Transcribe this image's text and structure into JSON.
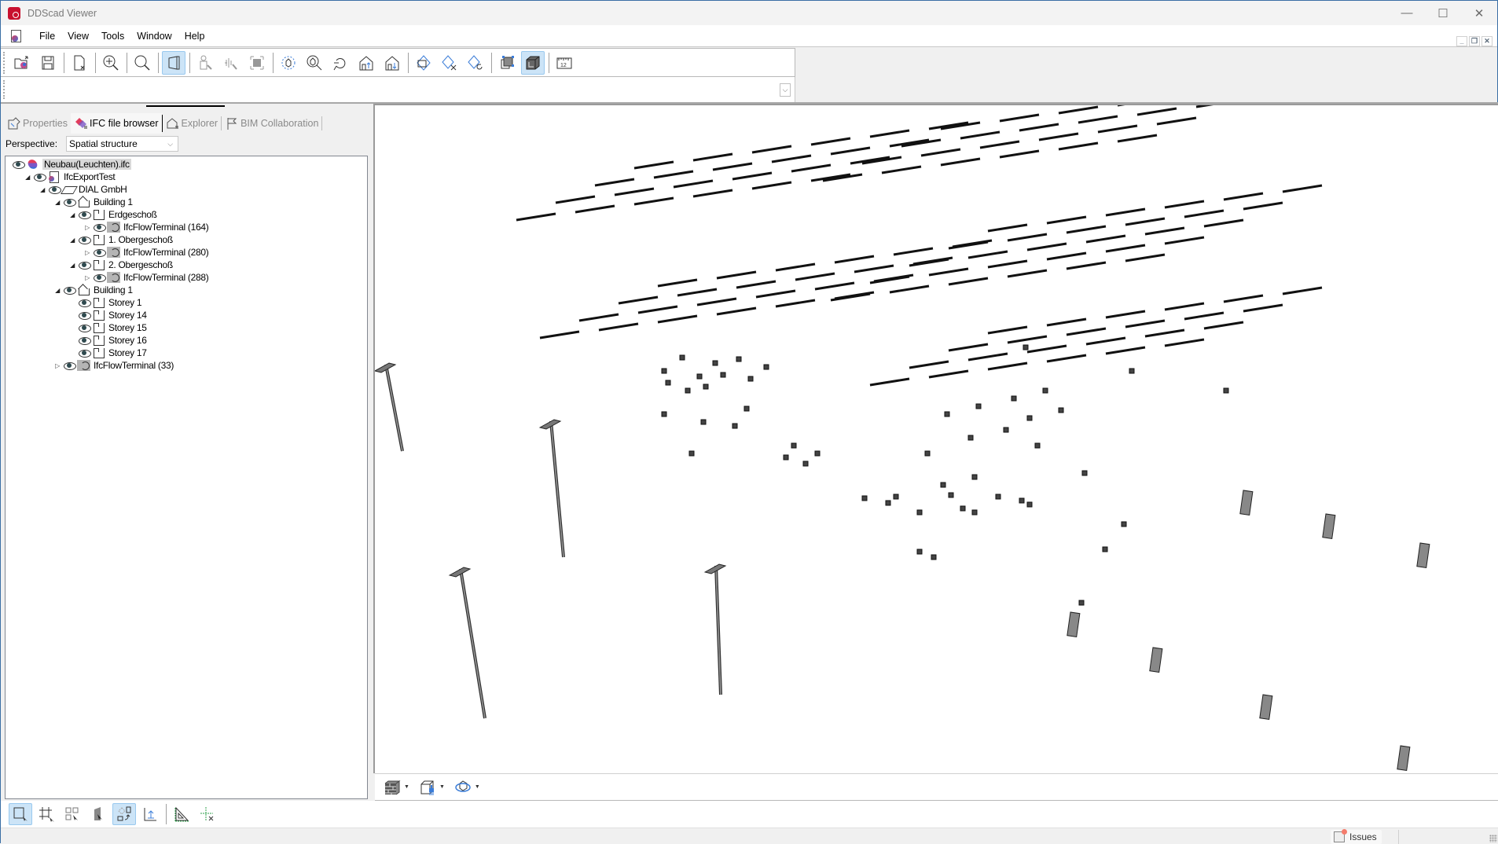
{
  "window": {
    "title": "DDScad Viewer",
    "controls": {
      "minimize": "—",
      "maximize": "☐",
      "close": "✕"
    }
  },
  "menubar": {
    "items": [
      "File",
      "View",
      "Tools",
      "Window",
      "Help"
    ],
    "mdi_controls": {
      "minimize": "_",
      "restore": "❐",
      "close": "✕"
    }
  },
  "toolbar": {
    "buttons": [
      {
        "name": "open-file",
        "icon": "folder-open-icon",
        "active": false
      },
      {
        "name": "save",
        "icon": "save-icon",
        "active": false
      },
      {
        "name": "close-file",
        "icon": "document-close-icon",
        "active": false
      },
      {
        "name": "zoom-extents",
        "icon": "zoom-extents-icon",
        "active": false
      },
      {
        "name": "zoom",
        "icon": "magnifier-icon",
        "active": false
      },
      {
        "name": "perspective",
        "icon": "perspective-box-icon",
        "active": true
      },
      {
        "name": "walk",
        "icon": "person-walk-icon",
        "active": false
      },
      {
        "name": "fly",
        "icon": "fly-icon",
        "active": false
      },
      {
        "name": "fit-selection",
        "icon": "fit-selection-icon",
        "active": false
      },
      {
        "name": "orbit",
        "icon": "orbit-icon",
        "active": false
      },
      {
        "name": "zoom-object",
        "icon": "zoom-object-icon",
        "active": false
      },
      {
        "name": "previous-view",
        "icon": "undo-view-icon",
        "active": false
      },
      {
        "name": "storey-up",
        "icon": "house-arrow-up-icon",
        "active": false
      },
      {
        "name": "storey-down",
        "icon": "house-arrow-down-icon",
        "active": false
      },
      {
        "name": "section-box",
        "icon": "section-box-icon",
        "active": false
      },
      {
        "name": "clip",
        "icon": "clip-scissors-icon",
        "active": false
      },
      {
        "name": "reset-clip",
        "icon": "clip-reset-icon",
        "active": false
      },
      {
        "name": "select-frame",
        "icon": "frame-select-icon",
        "active": false
      },
      {
        "name": "shaded-3d",
        "icon": "shaded-cube-icon",
        "active": true
      },
      {
        "name": "measure",
        "icon": "ruler-icon",
        "active": false
      }
    ]
  },
  "left_panel": {
    "tabs": [
      {
        "label": "Properties",
        "icon": "properties-icon",
        "active": false
      },
      {
        "label": "IFC file browser",
        "icon": "ifc-browser-icon",
        "active": true
      },
      {
        "label": "Explorer",
        "icon": "explorer-icon",
        "active": false
      },
      {
        "label": "BIM Collaboration",
        "icon": "flag-icon",
        "active": false
      }
    ],
    "perspective": {
      "label": "Perspective:",
      "value": "Spatial structure"
    },
    "tree": [
      {
        "label": "Neubau(Leuchten).ifc",
        "level": 0,
        "twisty": "",
        "icon": "ifc",
        "selected": true
      },
      {
        "label": "IfcExportTest",
        "level": 1,
        "twisty": "expanded",
        "icon": "doc"
      },
      {
        "label": "DIAL GmbH",
        "level": 2,
        "twisty": "expanded",
        "icon": "site"
      },
      {
        "label": "Building 1",
        "level": 3,
        "twisty": "expanded",
        "icon": "bldg"
      },
      {
        "label": "Erdgeschoß",
        "level": 4,
        "twisty": "expanded",
        "icon": "storey"
      },
      {
        "label": "IfcFlowTerminal (164)",
        "level": 5,
        "twisty": "collapsed",
        "icon": "term"
      },
      {
        "label": "1. Obergeschoß",
        "level": 4,
        "twisty": "expanded",
        "icon": "storey"
      },
      {
        "label": "IfcFlowTerminal (280)",
        "level": 5,
        "twisty": "collapsed",
        "icon": "term"
      },
      {
        "label": "2. Obergeschoß",
        "level": 4,
        "twisty": "expanded",
        "icon": "storey"
      },
      {
        "label": "IfcFlowTerminal (288)",
        "level": 5,
        "twisty": "collapsed",
        "icon": "term"
      },
      {
        "label": "Building 1",
        "level": 3,
        "twisty": "expanded",
        "icon": "bldg"
      },
      {
        "label": "Storey 1",
        "level": 4,
        "twisty": "",
        "icon": "storey"
      },
      {
        "label": "Storey 14",
        "level": 4,
        "twisty": "",
        "icon": "storey"
      },
      {
        "label": "Storey 15",
        "level": 4,
        "twisty": "",
        "icon": "storey"
      },
      {
        "label": "Storey 16",
        "level": 4,
        "twisty": "",
        "icon": "storey"
      },
      {
        "label": "Storey 17",
        "level": 4,
        "twisty": "",
        "icon": "storey"
      },
      {
        "label": "IfcFlowTerminal (33)",
        "level": 3,
        "twisty": "collapsed",
        "icon": "term"
      }
    ]
  },
  "viewport": {
    "scene": "3D model of light fixtures (IfcFlowTerminal) across storeys with street lamps and bollards",
    "toolbar": [
      {
        "name": "layers-dropdown",
        "icon": "brick-wall-icon"
      },
      {
        "name": "appearance-dropdown",
        "icon": "paint-cube-icon"
      },
      {
        "name": "view-rotation-dropdown",
        "icon": "rotate-cube-icon"
      }
    ]
  },
  "bottom_toolbar": {
    "buttons": [
      {
        "name": "select-element",
        "icon": "select-box-icon",
        "active": true
      },
      {
        "name": "select-grid",
        "icon": "grid-select-icon",
        "active": false
      },
      {
        "name": "select-multiple",
        "icon": "multi-select-icon",
        "active": false
      },
      {
        "name": "select-surface",
        "icon": "surface-select-icon",
        "active": false
      },
      {
        "name": "select-transform",
        "icon": "transform-select-icon",
        "active": true
      },
      {
        "name": "axis-origin",
        "icon": "axis-icon",
        "active": false
      },
      {
        "name": "measure-angle",
        "icon": "set-square-icon",
        "active": false
      },
      {
        "name": "clear-markers",
        "icon": "crosshair-x-icon",
        "active": false
      }
    ]
  },
  "statusbar": {
    "issues_label": "Issues"
  },
  "colors": {
    "accent_active_bg": "#cce4f7",
    "accent_active_border": "#99c9ef",
    "app_red": "#c8102e",
    "issues_dot": "#f47c6c"
  }
}
